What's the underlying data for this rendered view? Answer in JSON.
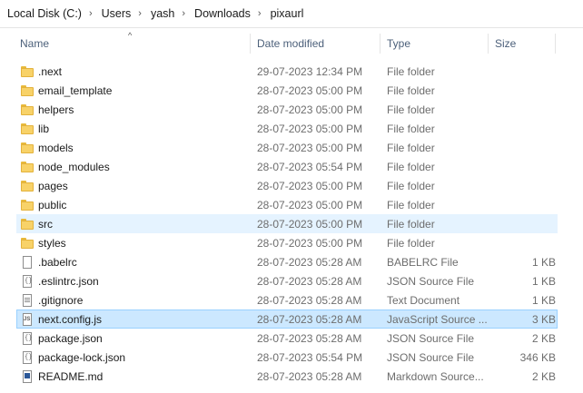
{
  "breadcrumb": [
    "Local Disk (C:)",
    "Users",
    "yash",
    "Downloads",
    "pixaurl"
  ],
  "breadcrumb_separator": "›",
  "columns": {
    "name": "Name",
    "date": "Date modified",
    "type": "Type",
    "size": "Size"
  },
  "sort_indicator": "^",
  "files": [
    {
      "name": ".next",
      "date": "29-07-2023 12:34 PM",
      "type": "File folder",
      "size": "",
      "icon": "folder-icon"
    },
    {
      "name": "email_template",
      "date": "28-07-2023 05:00 PM",
      "type": "File folder",
      "size": "",
      "icon": "folder-icon"
    },
    {
      "name": "helpers",
      "date": "28-07-2023 05:00 PM",
      "type": "File folder",
      "size": "",
      "icon": "folder-icon"
    },
    {
      "name": "lib",
      "date": "28-07-2023 05:00 PM",
      "type": "File folder",
      "size": "",
      "icon": "folder-icon"
    },
    {
      "name": "models",
      "date": "28-07-2023 05:00 PM",
      "type": "File folder",
      "size": "",
      "icon": "folder-icon"
    },
    {
      "name": "node_modules",
      "date": "28-07-2023 05:54 PM",
      "type": "File folder",
      "size": "",
      "icon": "folder-icon"
    },
    {
      "name": "pages",
      "date": "28-07-2023 05:00 PM",
      "type": "File folder",
      "size": "",
      "icon": "folder-icon"
    },
    {
      "name": "public",
      "date": "28-07-2023 05:00 PM",
      "type": "File folder",
      "size": "",
      "icon": "folder-icon"
    },
    {
      "name": "src",
      "date": "28-07-2023 05:00 PM",
      "type": "File folder",
      "size": "",
      "icon": "folder-icon",
      "state": "hover"
    },
    {
      "name": "styles",
      "date": "28-07-2023 05:00 PM",
      "type": "File folder",
      "size": "",
      "icon": "folder-icon"
    },
    {
      "name": ".babelrc",
      "date": "28-07-2023 05:28 AM",
      "type": "BABELRC File",
      "size": "1 KB",
      "icon": "file-icon"
    },
    {
      "name": ".eslintrc.json",
      "date": "28-07-2023 05:28 AM",
      "type": "JSON Source File",
      "size": "1 KB",
      "icon": "json-icon"
    },
    {
      "name": ".gitignore",
      "date": "28-07-2023 05:28 AM",
      "type": "Text Document",
      "size": "1 KB",
      "icon": "txt-icon"
    },
    {
      "name": "next.config.js",
      "date": "28-07-2023 05:28 AM",
      "type": "JavaScript Source ...",
      "size": "3 KB",
      "icon": "js-icon",
      "state": "selected"
    },
    {
      "name": "package.json",
      "date": "28-07-2023 05:28 AM",
      "type": "JSON Source File",
      "size": "2 KB",
      "icon": "json-icon"
    },
    {
      "name": "package-lock.json",
      "date": "28-07-2023 05:54 PM",
      "type": "JSON Source File",
      "size": "346 KB",
      "icon": "json-icon"
    },
    {
      "name": "README.md",
      "date": "28-07-2023 05:28 AM",
      "type": "Markdown Source...",
      "size": "2 KB",
      "icon": "md-icon"
    }
  ]
}
